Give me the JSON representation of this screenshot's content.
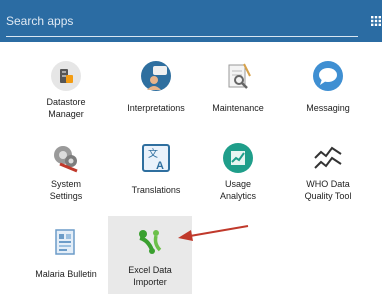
{
  "search": {
    "placeholder": "Search apps"
  },
  "apps": [
    {
      "label": "Datastore Manager",
      "label_lines": [
        "Datastore",
        "Manager"
      ],
      "icon": "datastore-manager-icon"
    },
    {
      "label": "Interpretations",
      "label_lines": [
        "Interpretations"
      ],
      "icon": "interpretations-icon"
    },
    {
      "label": "Maintenance",
      "label_lines": [
        "Maintenance"
      ],
      "icon": "maintenance-icon"
    },
    {
      "label": "Messaging",
      "label_lines": [
        "Messaging"
      ],
      "icon": "messaging-icon"
    },
    {
      "label": "System Settings",
      "label_lines": [
        "System",
        "Settings"
      ],
      "icon": "system-settings-icon"
    },
    {
      "label": "Translations",
      "label_lines": [
        "Translations"
      ],
      "icon": "translations-icon"
    },
    {
      "label": "Usage Analytics",
      "label_lines": [
        "Usage",
        "Analytics"
      ],
      "icon": "usage-analytics-icon"
    },
    {
      "label": "WHO Data Quality Tool",
      "label_lines": [
        "WHO Data",
        "Quality Tool"
      ],
      "icon": "who-data-quality-icon"
    },
    {
      "label": "Malaria Bulletin",
      "label_lines": [
        "Malaria Bulletin"
      ],
      "icon": "malaria-bulletin-icon"
    },
    {
      "label": "Excel Data Importer",
      "label_lines": [
        "Excel Data",
        "Importer"
      ],
      "icon": "excel-data-importer-icon"
    }
  ],
  "colors": {
    "header_bg": "#2b6ca3",
    "highlight_tile": "#e9e9e9",
    "arrow": "#c0392b"
  }
}
